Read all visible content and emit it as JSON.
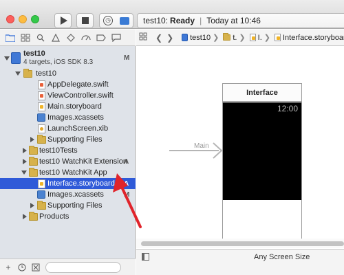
{
  "window": {
    "activity": {
      "target": "test10:",
      "status": "Ready",
      "separator": "|",
      "timestamp": "Today at 10:46"
    }
  },
  "navigator": {
    "project": {
      "name": "test10",
      "subtitle": "4 targets, iOS SDK 8.3",
      "badge": "M"
    },
    "items": [
      {
        "label": "test10",
        "badge": ""
      },
      {
        "label": "AppDelegate.swift",
        "badge": ""
      },
      {
        "label": "ViewController.swift",
        "badge": ""
      },
      {
        "label": "Main.storyboard",
        "badge": ""
      },
      {
        "label": "Images.xcassets",
        "badge": ""
      },
      {
        "label": "LaunchScreen.xib",
        "badge": ""
      },
      {
        "label": "Supporting Files",
        "badge": ""
      },
      {
        "label": "test10Tests",
        "badge": ""
      },
      {
        "label": "test10 WatchKit Extension",
        "badge": "A"
      },
      {
        "label": "test10 WatchKit App",
        "badge": ""
      },
      {
        "label": "Interface.storyboard",
        "badge": "A"
      },
      {
        "label": "Images.xcassets",
        "badge": "M"
      },
      {
        "label": "Supporting Files",
        "badge": ""
      },
      {
        "label": "Products",
        "badge": ""
      }
    ]
  },
  "jumpbar": {
    "crumbs": [
      "test10",
      "t.",
      "I.",
      "Interface.storyboard (B"
    ]
  },
  "canvas": {
    "scene_title": "Interface",
    "watch_time": "12:00",
    "entry_label": "Main"
  },
  "footer": {
    "size_class": "Any Screen Size"
  },
  "colors": {
    "selection": "#2f5ad8",
    "annotation_arrow": "#e0242b"
  }
}
